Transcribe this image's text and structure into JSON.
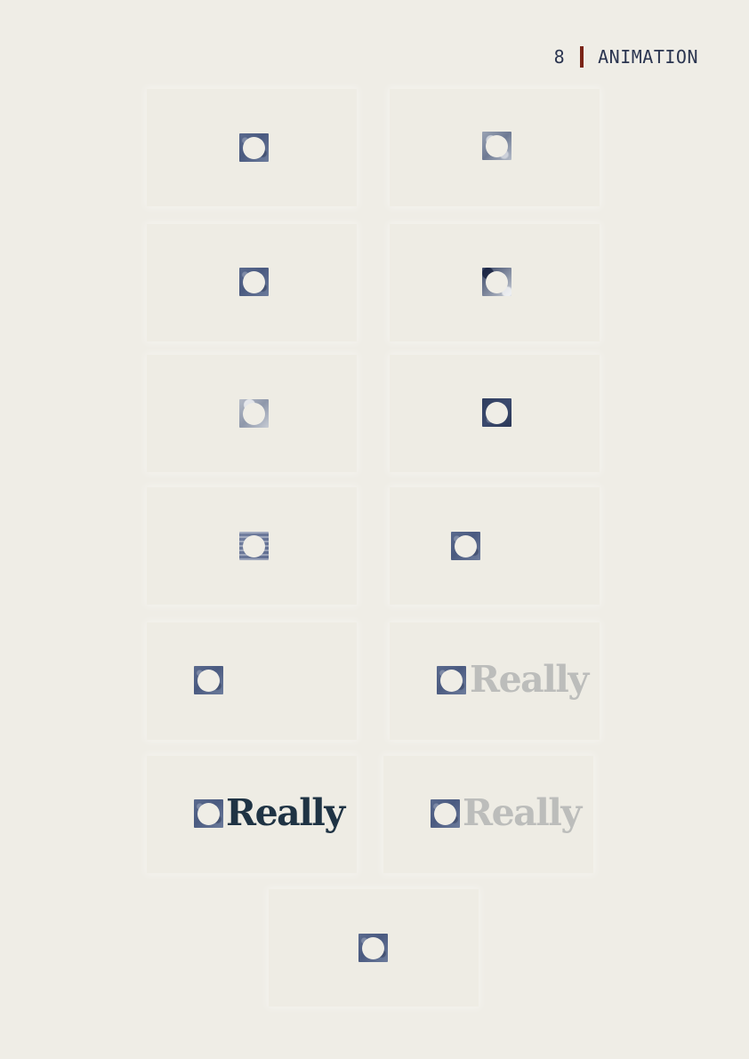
{
  "header": {
    "page_number": "8",
    "section_title": "ANIMATION"
  },
  "frames": [
    {
      "id": "frame-1",
      "mark_style": "main",
      "word": ""
    },
    {
      "id": "frame-2",
      "mark_style": "light",
      "word": ""
    },
    {
      "id": "frame-3",
      "mark_style": "main",
      "word": ""
    },
    {
      "id": "frame-4",
      "mark_style": "mixed",
      "word": ""
    },
    {
      "id": "frame-5",
      "mark_style": "faded",
      "word": ""
    },
    {
      "id": "frame-6",
      "mark_style": "dark",
      "word": ""
    },
    {
      "id": "frame-7",
      "mark_style": "stripe",
      "word": ""
    },
    {
      "id": "frame-8",
      "mark_style": "main",
      "word": ""
    },
    {
      "id": "frame-9",
      "mark_style": "main",
      "word": ""
    },
    {
      "id": "frame-10",
      "mark_style": "main",
      "word": "Really",
      "word_tone": "grey"
    },
    {
      "id": "frame-11",
      "mark_style": "main",
      "word": "Really",
      "word_tone": "dark"
    },
    {
      "id": "frame-12",
      "mark_style": "main",
      "word": "Really",
      "word_tone": "grey"
    },
    {
      "id": "frame-13",
      "mark_style": "main",
      "word": ""
    }
  ],
  "colors": {
    "background": "#efede6",
    "accent_bar": "#7a2417",
    "header_text": "#2b3550",
    "wordmark_dark": "#1f3344",
    "wordmark_grey": "#bcbdbb",
    "mark_blue": "#4f5f86"
  }
}
